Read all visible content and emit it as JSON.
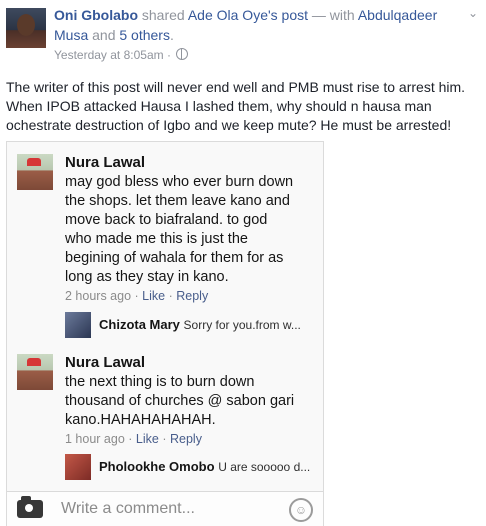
{
  "post": {
    "author": "Oni Gbolabo",
    "action": "shared",
    "shared_from": "Ade Ola Oye's post",
    "with_prefix": "— with",
    "tagged_1": "Abdulqadeer",
    "tagged_1b": "Musa",
    "and_word": "and",
    "others": "5 others",
    "period": ".",
    "time": "Yesterday at 8:05am",
    "separator": "·",
    "text": "The writer of this post will never end well and PMB must rise to arrest him. When IPOB attacked Hausa I lashed them, why should n hausa man ochestrate destruction of Igbo and we keep mute? He must be arrested!"
  },
  "screenshot": {
    "comments": [
      {
        "name": "Nura Lawal",
        "lines": [
          "may god bless who ever burn down",
          "the shops. let them leave kano and",
          "move back to biafraland. to god",
          "who made me this is just the",
          "begining of wahala for them for as",
          "long as they stay in kano."
        ],
        "time": "2 hours ago",
        "like": "Like",
        "reply": "Reply",
        "dot": "·",
        "reply_preview": {
          "name": "Chizota Mary",
          "text": "Sorry for you.from w..."
        }
      },
      {
        "name": "Nura Lawal",
        "lines": [
          "the next thing is to burn down",
          "thousand of churches @ sabon gari",
          "kano.HAHAHAHAHAH."
        ],
        "time": "1 hour ago",
        "like": "Like",
        "reply": "Reply",
        "dot": "·",
        "reply_preview": {
          "name": "Pholookhe Omobo",
          "text": "U are sooooo d..."
        }
      }
    ],
    "write_placeholder": "Write a comment..."
  }
}
